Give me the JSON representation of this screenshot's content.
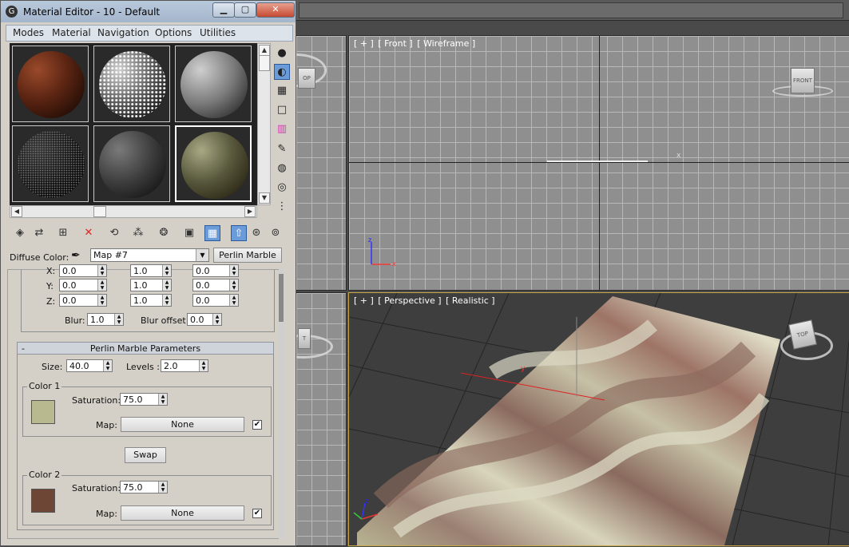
{
  "window": {
    "title": "Material Editor - 10 - Default",
    "app_icon": "3ds-max-logo-icon",
    "minimize": "▁",
    "maximize": "▢",
    "close": "✕"
  },
  "menu": [
    "Modes",
    "Material",
    "Navigation",
    "Options",
    "Utilities"
  ],
  "viewports": {
    "front": {
      "label_1": "[ + ]",
      "label_2": "[ Front ]",
      "label_3": "[ Wireframe ]",
      "cube_label": "FRONT",
      "axis_x": "x"
    },
    "perspective": {
      "label_1": "[ + ]",
      "label_2": "[ Perspective ]",
      "label_3": "[ Realistic ]",
      "axis_y": "y"
    }
  },
  "diffuse": {
    "label": "Diffuse Color:",
    "map_value": "Map #7",
    "type_button": "Perlin Marble"
  },
  "coordinates": {
    "rows": [
      {
        "axis": "X:",
        "a": "0.0",
        "b": "1.0",
        "c": "0.0"
      },
      {
        "axis": "Y:",
        "a": "0.0",
        "b": "1.0",
        "c": "0.0"
      },
      {
        "axis": "Z:",
        "a": "0.0",
        "b": "1.0",
        "c": "0.0"
      }
    ],
    "blur_label": "Blur:",
    "blur_value": "1.0",
    "blur_offset_label": "Blur offset:",
    "blur_offset_value": "0.0"
  },
  "perlin": {
    "rollout_toggle": "-",
    "rollout_title": "Perlin Marble Parameters",
    "size_label": "Size:",
    "size_value": "40.0",
    "levels_label": "Levels :",
    "levels_value": "2.0",
    "swap_label": "Swap",
    "color1": {
      "title": "Color 1",
      "swatch": "#b9b98f",
      "saturation_label": "Saturation:",
      "saturation_value": "75.0",
      "map_label": "Map:",
      "map_button": "None",
      "checked": "✔"
    },
    "color2": {
      "title": "Color 2",
      "swatch": "#6e4636",
      "saturation_label": "Saturation:",
      "saturation_value": "75.0",
      "map_label": "Map:",
      "map_button": "None",
      "checked": "✔"
    }
  },
  "colors": {
    "viewport_active_border": "#c8a84a",
    "toolbar_active": "#6b9bd8"
  }
}
